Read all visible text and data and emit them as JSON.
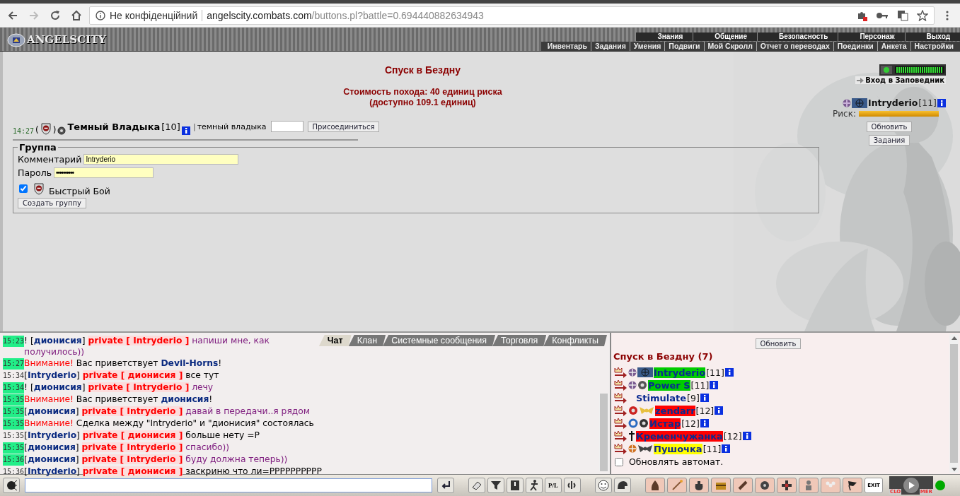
{
  "browser": {
    "security_label": "Не конфіденційний",
    "url_host": "angelscity.combats.com",
    "url_path": "/buttons.pl?battle=0.694440882634943"
  },
  "header": {
    "logo": "ANGELSCITY",
    "top_menu": [
      "Знания",
      "Общение",
      "Безопасность",
      "Персонаж",
      "Выход"
    ],
    "sub_menu": [
      "Инвентарь",
      "Задания",
      "Умения",
      "Подвиги",
      "Мой Скролл",
      "Отчет о переводах",
      "Поединки",
      "Анкета",
      "Настройки"
    ]
  },
  "main": {
    "title": "Спуск в Бездну",
    "cost": "Стоимость похода: 40 единиц риска",
    "available": "(доступно 109.1 единиц)",
    "application": {
      "time": "14:27",
      "open_paren": "(",
      "close_paren": ")",
      "leader": "Темный Владыка",
      "level": "[10]",
      "separator": "|",
      "comment": "темный владыка",
      "join_button": "Присоединиться"
    },
    "group": {
      "legend": "Группа",
      "comment_label": "Комментарий",
      "comment_value": "Intryderio",
      "password_label": "Пароль",
      "password_value": "••••••••••",
      "quick_fight": {
        "label": "Быстрый Бой",
        "checked": true
      },
      "create_button": "Создать группу"
    }
  },
  "character": {
    "reserve_link": "Вход в Заповедник",
    "name": "Intryderio",
    "level": "[11]",
    "risk": {
      "label": "Риск:",
      "level": 1
    },
    "refresh_button": "Обновить",
    "quests_button": "Задания"
  },
  "chat_tabs": [
    {
      "label": "Чат",
      "selected": true
    },
    {
      "label": "Клан",
      "selected": false
    },
    {
      "label": "Системные сообщения",
      "selected": false
    },
    {
      "label": "Торговля",
      "selected": false
    },
    {
      "label": "Конфликты",
      "selected": false
    }
  ],
  "messages": [
    {
      "time": "15:23",
      "time_highlighted": true,
      "parts": [
        {
          "kind": "text",
          "text": "! ["
        },
        {
          "kind": "nick",
          "text": "дионисия"
        },
        {
          "kind": "text",
          "text": "] "
        },
        {
          "kind": "private",
          "text": "private [ Intryderio ]"
        },
        {
          "kind": "incoming",
          "text": " напиши мне, как получилось))"
        }
      ]
    },
    {
      "time": "15:27",
      "time_highlighted": true,
      "parts": [
        {
          "kind": "alert",
          "text": "Внимание!"
        },
        {
          "kind": "text",
          "text": " Вас приветствует "
        },
        {
          "kind": "nick",
          "text": "Devil-Horns"
        },
        {
          "kind": "text",
          "text": "!"
        }
      ]
    },
    {
      "time": "15:34",
      "time_highlighted": false,
      "parts": [
        {
          "kind": "text",
          "text": "["
        },
        {
          "kind": "nick",
          "text": "Intryderio"
        },
        {
          "kind": "text",
          "text": "] "
        },
        {
          "kind": "private",
          "text": "private [ дионисия ]"
        },
        {
          "kind": "text",
          "text": " все тут"
        }
      ]
    },
    {
      "time": "15:34",
      "time_highlighted": true,
      "parts": [
        {
          "kind": "text",
          "text": "! ["
        },
        {
          "kind": "nick",
          "text": "дионисия"
        },
        {
          "kind": "text",
          "text": "] "
        },
        {
          "kind": "private",
          "text": "private [ Intryderio ]"
        },
        {
          "kind": "incoming",
          "text": " лечу"
        }
      ]
    },
    {
      "time": "15:35",
      "time_highlighted": true,
      "parts": [
        {
          "kind": "alert",
          "text": "Внимание!"
        },
        {
          "kind": "text",
          "text": " Вас приветствует "
        },
        {
          "kind": "nick",
          "text": "дионисия"
        },
        {
          "kind": "text",
          "text": "!"
        }
      ]
    },
    {
      "time": "15:35",
      "time_highlighted": true,
      "parts": [
        {
          "kind": "text",
          "text": "["
        },
        {
          "kind": "nick",
          "text": "дионисия"
        },
        {
          "kind": "text",
          "text": "] "
        },
        {
          "kind": "private",
          "text": "private [ Intryderio ]"
        },
        {
          "kind": "incoming",
          "text": " давай в передачи..я рядом"
        }
      ]
    },
    {
      "time": "15:35",
      "time_highlighted": true,
      "parts": [
        {
          "kind": "alert",
          "text": "Внимание!"
        },
        {
          "kind": "text",
          "text": " Сделка между \"Intryderio\" и \"дионисия\" состоялась"
        }
      ]
    },
    {
      "time": "15:35",
      "time_highlighted": false,
      "parts": [
        {
          "kind": "text",
          "text": "["
        },
        {
          "kind": "nick",
          "text": "Intryderio"
        },
        {
          "kind": "text",
          "text": "] "
        },
        {
          "kind": "private",
          "text": "private [ дионисия ]"
        },
        {
          "kind": "text",
          "text": " больше нету =Р"
        }
      ]
    },
    {
      "time": "15:35",
      "time_highlighted": true,
      "parts": [
        {
          "kind": "text",
          "text": "["
        },
        {
          "kind": "nick",
          "text": "дионисия"
        },
        {
          "kind": "text",
          "text": "] "
        },
        {
          "kind": "private",
          "text": "private [ Intryderio ]"
        },
        {
          "kind": "incoming",
          "text": " спасибо))"
        }
      ]
    },
    {
      "time": "15:36",
      "time_highlighted": true,
      "parts": [
        {
          "kind": "text",
          "text": "["
        },
        {
          "kind": "nick",
          "text": "дионисия"
        },
        {
          "kind": "text",
          "text": "] "
        },
        {
          "kind": "private",
          "text": "private [ Intryderio ]"
        },
        {
          "kind": "incoming",
          "text": " буду должна теперь))"
        }
      ]
    },
    {
      "time": "15:36",
      "time_highlighted": false,
      "parts": [
        {
          "kind": "text",
          "text": "["
        },
        {
          "kind": "nick",
          "text": "Intryderio"
        },
        {
          "kind": "text",
          "text": "] "
        },
        {
          "kind": "private",
          "text": "private [ дионисия ]"
        },
        {
          "kind": "text",
          "text": " заскриню что ли=PPPPPPPPPP"
        }
      ]
    }
  ],
  "location": {
    "refresh_button": "Обновить",
    "title": "Спуск в Бездну (7)",
    "players": [
      {
        "name": "Intryderio",
        "level": "[11]",
        "color": "#00cc00",
        "badges": [
          {
            "kind": "emblem",
            "color": "#7a5a90"
          },
          {
            "kind": "rank",
            "color": "#3a5a8a"
          }
        ]
      },
      {
        "name": "Power S",
        "level": "[11]",
        "color": "#00cc00",
        "badges": [
          {
            "kind": "emblem",
            "color": "#7a5a90"
          },
          {
            "kind": "orb",
            "color": "#555555"
          }
        ]
      },
      {
        "name": "Stimulate",
        "level": "[9]"
      },
      {
        "name": "zendarr",
        "level": "[12]",
        "color": "#ff0000",
        "badges": [
          {
            "kind": "orb",
            "color": "#cc2222"
          },
          {
            "kind": "wings",
            "color": "#e8c040"
          }
        ]
      },
      {
        "name": "Истар",
        "level": "[12]",
        "color": "#ff0000",
        "badges": [
          {
            "kind": "ring",
            "color": "#2a6ac0"
          },
          {
            "kind": "orb",
            "color": "#333333"
          }
        ]
      },
      {
        "name": "Кременчужанка",
        "level": "[12]",
        "color": "#ff0000",
        "badges": [
          {
            "kind": "cross",
            "color": "#111111"
          }
        ]
      },
      {
        "name": "Пушочка",
        "level": "[11]",
        "color": "#ffff00",
        "badges": [
          {
            "kind": "emblem",
            "color": "#d07020"
          },
          {
            "kind": "wings",
            "color": "#444444"
          }
        ]
      }
    ],
    "auto_refresh": {
      "label": "Обновлять автомат.",
      "checked": false
    }
  },
  "toolbar": {
    "pl_label": "P/L",
    "exit_label": "EXIT",
    "timer_left": "CLO",
    "timer_right": "MER"
  }
}
